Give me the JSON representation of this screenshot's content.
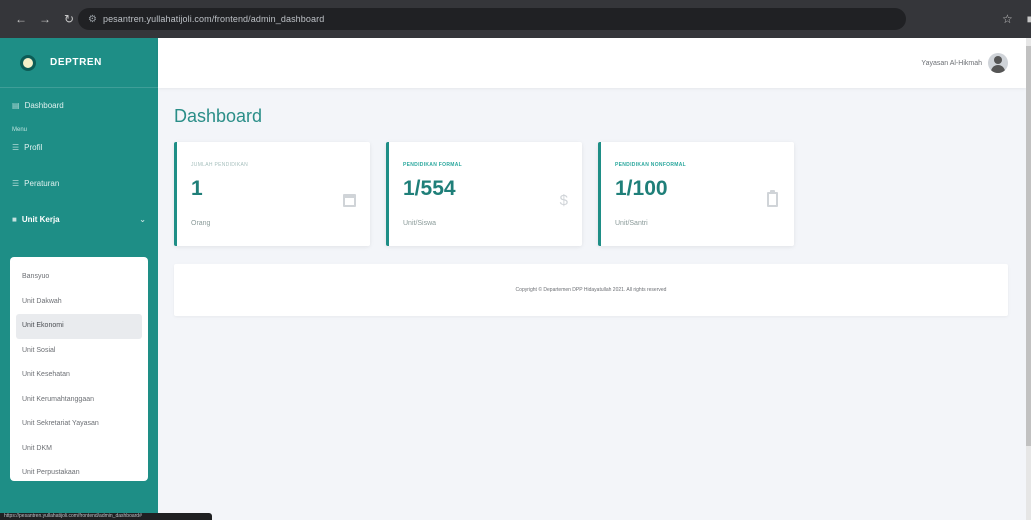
{
  "browser": {
    "url": "pesantren.yullahatijoli.com/frontend/admin_dashboard"
  },
  "sidebar": {
    "brand": "DEPTREN",
    "dashboard": "Dashboard",
    "heading": "Menu",
    "profil": "Profil",
    "peraturan": "Peraturan",
    "unit_kerja": "Unit Kerja",
    "submenu": [
      "Bansyuo",
      "Unit Dakwah",
      "Unit Ekonomi",
      "Unit Sosial",
      "Unit Kesehatan",
      "Unit Kerumahtanggaan",
      "Unit Sekretariat Yayasan",
      "Unit DKM",
      "Unit Perpustakaan"
    ]
  },
  "topbar": {
    "user": "Yayasan Al-Hikmah"
  },
  "main": {
    "title": "Dashboard",
    "cards": [
      {
        "label": "JUMLAH PENDIDIKAN",
        "value": "1",
        "unit": "Orang"
      },
      {
        "label": "PENDIDIKAN FORMAL",
        "value": "1/554",
        "unit": "Unit/Siswa"
      },
      {
        "label": "PENDIDIKAN NONFORMAL",
        "value": "1/100",
        "unit": "Unit/Santri"
      }
    ],
    "footer": "Copyright © Departemen DPP Hidayatullah 2021. All rights reserved"
  },
  "status": {
    "text": "https://pesantren.yullahatijoli.com/frontend/admin_dashboard#"
  }
}
